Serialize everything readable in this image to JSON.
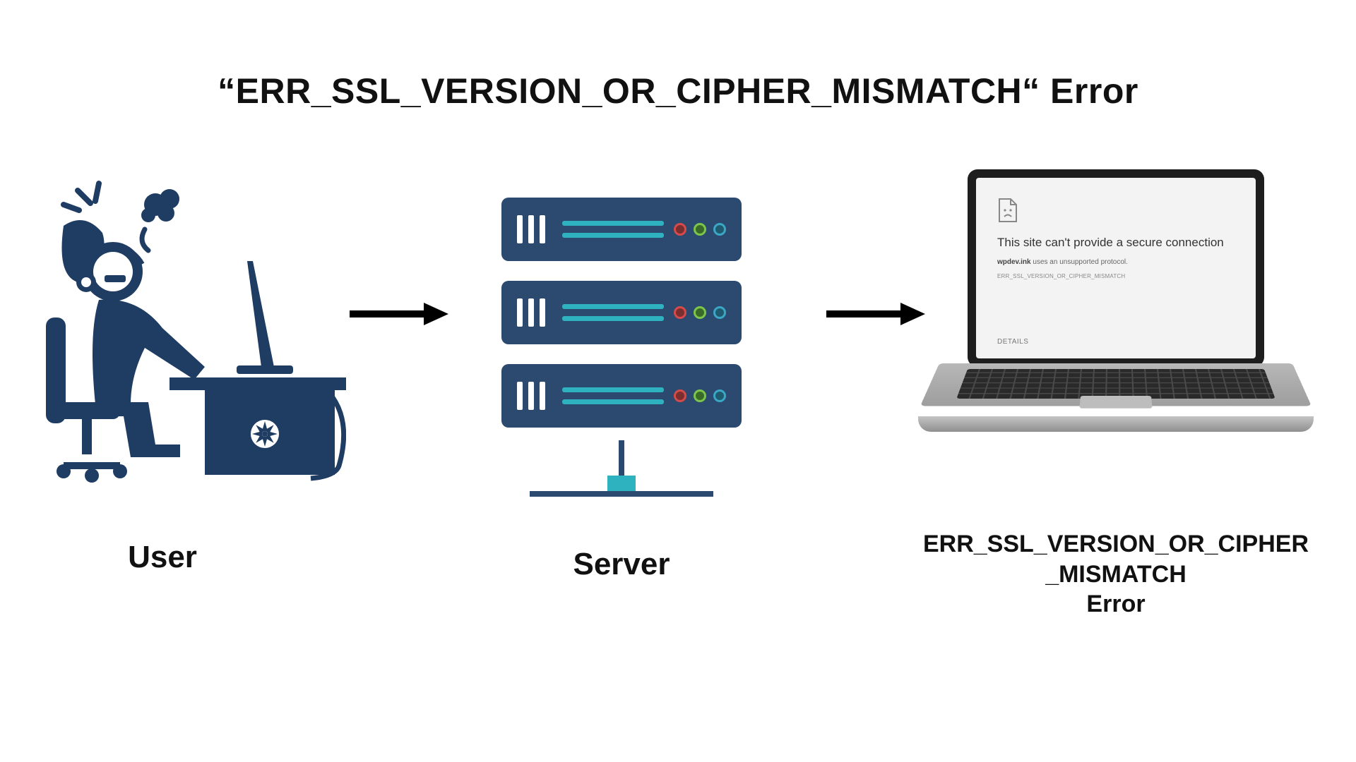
{
  "title": "“ERR_SSL_VERSION_OR_CIPHER_MISMATCH“ Error",
  "labels": {
    "user": "User",
    "server": "Server",
    "error_line1": "ERR_SSL_VERSION_OR_CIPHER",
    "error_line2": "_MISMATCH",
    "error_line3": "Error"
  },
  "browser_error": {
    "heading": "This site can't provide a secure connection",
    "domain": "wpdev.ink",
    "message_suffix": " uses an unsupported protocol.",
    "code": "ERR_SSL_VERSION_OR_CIPHER_MISMATCH",
    "details_label": "DETAILS"
  },
  "colors": {
    "navy": "#2c4a6f",
    "teal": "#2fb2bf",
    "led_red": "#d64a4a",
    "led_green": "#7cc54b",
    "led_blue": "#3aa7c7"
  }
}
